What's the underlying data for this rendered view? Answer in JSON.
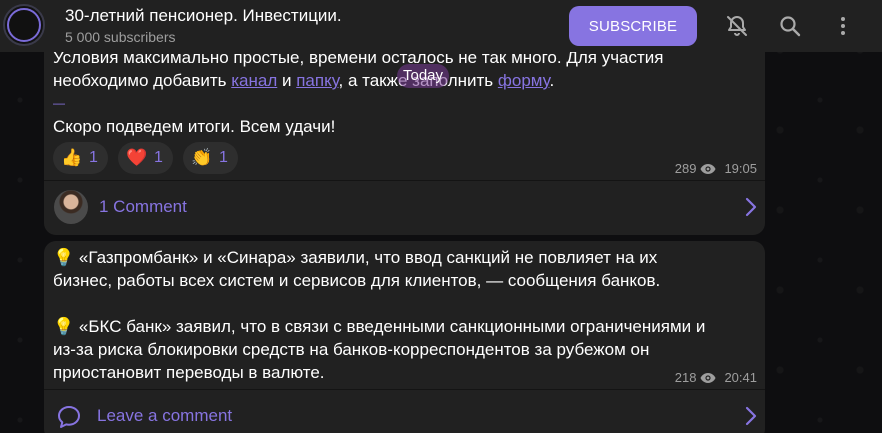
{
  "channel": {
    "title": "30-летний пенсионер. Инвестиции.",
    "subscribers": "5 000 subscribers",
    "subscribe_label": "SUBSCRIBE"
  },
  "header_icons": [
    "bell-muted-icon",
    "search-icon",
    "more-vertical-icon"
  ],
  "date_pill": "Today",
  "post1": {
    "line1": "Условия максимально простые, времени осталось не так много. Для участия",
    "line2_prefix": "необходимо добавить ",
    "link1": "канал",
    "mid1": " и ",
    "link2": "папку",
    "mid2": ", а также заполнить ",
    "link3": "форму",
    "suffix": ".",
    "dash": "—",
    "line3": "Скоро подведем итоги. Всем удачи!",
    "reactions": [
      {
        "emoji": "👍",
        "count": "1"
      },
      {
        "emoji": "❤️",
        "count": "1"
      },
      {
        "emoji": "👏",
        "count": "1"
      }
    ],
    "views": "289",
    "time": "19:05",
    "comments": "1 Comment"
  },
  "post2": {
    "para1_line1": "💡  «Газпромбанк» и «Синара» заявили, что ввод санкций не повлияет на их",
    "para1_line2": "бизнес, работы всех систем и сервисов для клиентов, — сообщения банков.",
    "para2_line1": "💡 «БКС банк» заявил, что в связи с введенными санкционными ограничениями и",
    "para2_line2": "из-за риска блокировки средств на банков-корреспондентов за рубежом он",
    "para2_line3": "приостановит переводы в валюте.",
    "views": "218",
    "time": "20:41",
    "comments": "Leave a comment"
  },
  "colors": {
    "accent": "#8774e1",
    "bubble": "#212121",
    "header": "#212121",
    "muted_text": "#9e9e9e"
  }
}
